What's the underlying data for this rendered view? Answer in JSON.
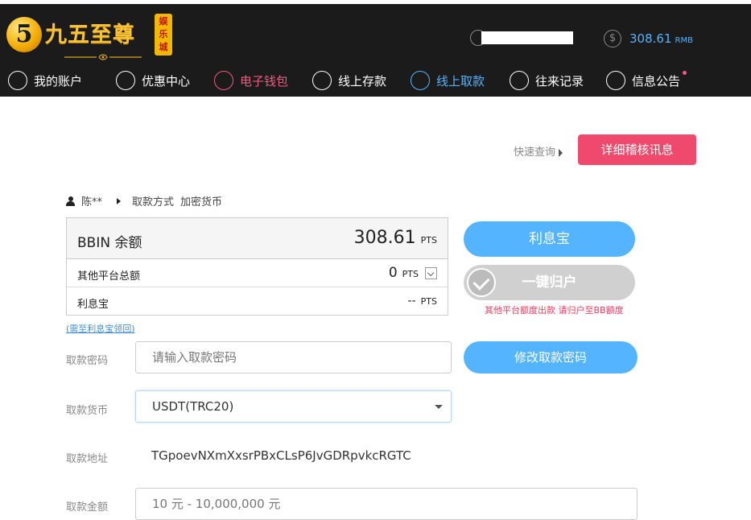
{
  "header": {
    "logo": {
      "badge": "5",
      "brand": "九五至尊",
      "seal": "娱乐城"
    },
    "balance": {
      "amount": "308.61",
      "unit": "RMB"
    },
    "icons": {
      "user": "user-icon",
      "coin": "dollar-coin-icon"
    }
  },
  "nav": {
    "items": [
      {
        "label": "我的账户",
        "icon": "user-icon",
        "state": "normal"
      },
      {
        "label": "优惠中心",
        "icon": "gift-icon",
        "state": "normal"
      },
      {
        "label": "电子钱包",
        "icon": "wallet-icon",
        "state": "active-red"
      },
      {
        "label": "线上存款",
        "icon": "deposit-icon",
        "state": "normal"
      },
      {
        "label": "线上取款",
        "icon": "withdraw-icon",
        "state": "active-blue"
      },
      {
        "label": "往来记录",
        "icon": "records-icon",
        "state": "normal"
      },
      {
        "label": "信息公告",
        "icon": "bell-icon",
        "state": "normal",
        "badge_dot": true
      }
    ]
  },
  "actions": {
    "quick_query": "快速查询",
    "detail_audit": "详细稽核讯息"
  },
  "account": {
    "name": "陈**",
    "method_label": "取款方式",
    "method_value": "加密货币"
  },
  "balances": {
    "main": {
      "label": "BBIN 余额",
      "value": "308.61",
      "unit": "PTS"
    },
    "other": {
      "label": "其他平台总额",
      "value": "0",
      "unit": "PTS"
    },
    "lixibao": {
      "label": "利息宝",
      "value": "--",
      "unit": "PTS"
    },
    "tip": "(需至利息宝领回)"
  },
  "buttons": {
    "lixibao": "利息宝",
    "one_key": "一键归户",
    "one_key_note": "其他平台额度出款 请归户至BB额度",
    "change_pwd": "修改取款密码"
  },
  "form": {
    "password": {
      "label": "取款密码",
      "placeholder": "请输入取款密码"
    },
    "currency": {
      "label": "取款货币",
      "value": "USDT(TRC20)"
    },
    "address": {
      "label": "取款地址",
      "value": "TGpoevNXmXxsrPBxCLsP6JvGDRpvkcRGTC"
    },
    "amount": {
      "label": "取款金额",
      "placeholder": "10 元 - 10,000,000 元"
    }
  },
  "colors": {
    "accent_blue": "#55b4ff",
    "accent_red": "#f0496e",
    "header_bg": "#1b1b1b",
    "disabled": "#d0d0d0"
  }
}
